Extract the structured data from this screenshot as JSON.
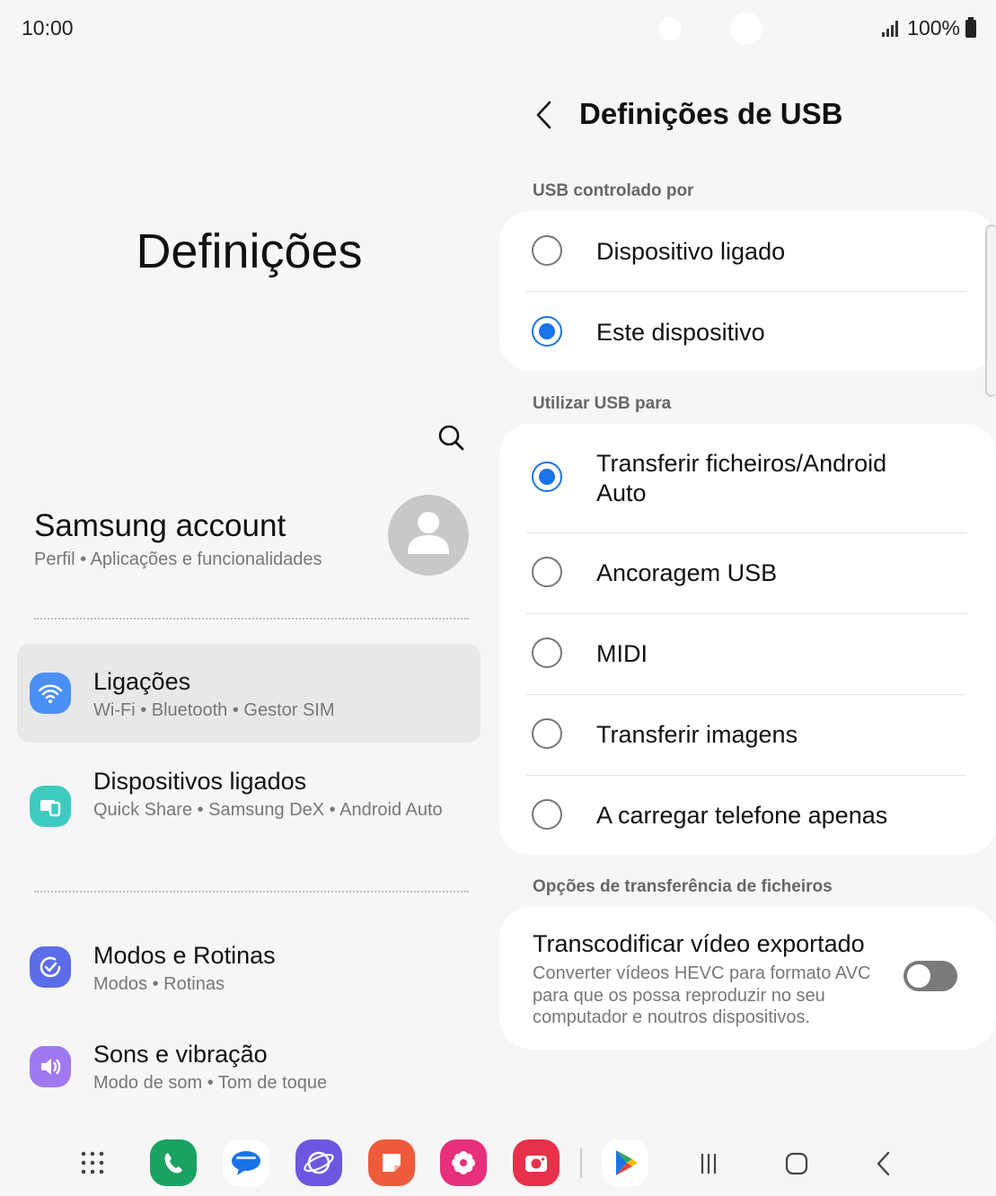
{
  "status_bar": {
    "time": "10:00",
    "battery": "100%",
    "icons": [
      "signal-icon",
      "battery-icon"
    ]
  },
  "left_pane": {
    "title": "Definições",
    "account": {
      "title": "Samsung account",
      "subtitle": "Perfil  •  Aplicações e funcionalidades"
    },
    "items": [
      {
        "title": "Ligações",
        "subtitle": "Wi-Fi  •  Bluetooth  •  Gestor SIM",
        "icon": "wifi-icon",
        "color": "#4a90f7"
      },
      {
        "title": "Dispositivos ligados",
        "subtitle": "Quick Share  •  Samsung DeX  •  Android Auto",
        "icon": "connected-devices-icon",
        "color": "#3ecbbf"
      },
      {
        "title": "Modos e Rotinas",
        "subtitle": "Modos  •  Rotinas",
        "icon": "modes-routines-icon",
        "color": "#5b6de8"
      },
      {
        "title": "Sons e vibração",
        "subtitle": "Modo de som  •  Tom de toque",
        "icon": "sound-icon",
        "color": "#a078ef"
      }
    ]
  },
  "right_pane": {
    "header_title": "Definições de USB",
    "sections": [
      {
        "label": "USB controlado por",
        "options": [
          {
            "label": "Dispositivo ligado",
            "checked": false
          },
          {
            "label": "Este dispositivo",
            "checked": true
          }
        ]
      },
      {
        "label": "Utilizar USB para",
        "options": [
          {
            "label": "Transferir ficheiros/Android Auto",
            "checked": true
          },
          {
            "label": "Ancoragem USB",
            "checked": false
          },
          {
            "label": "MIDI",
            "checked": false
          },
          {
            "label": "Transferir imagens",
            "checked": false
          },
          {
            "label": "A carregar telefone apenas",
            "checked": false
          }
        ]
      },
      {
        "label": "Opções de transferência de ficheiros",
        "toggle": {
          "title": "Transcodificar vídeo exportado",
          "description": "Converter vídeos HEVC para formato AVC para que os possa reproduzir no seu computador e noutros dispositivos.",
          "enabled": false
        }
      }
    ]
  },
  "dock": {
    "apps": [
      {
        "name": "apps-grid-icon"
      },
      {
        "name": "phone-icon",
        "color": "#1aa260"
      },
      {
        "name": "messages-icon",
        "color": "#1a73e8"
      },
      {
        "name": "internet-icon",
        "color": "#6e56e0"
      },
      {
        "name": "notes-icon",
        "color": "#ef5a3a"
      },
      {
        "name": "gallery-icon",
        "color": "#e8307a"
      },
      {
        "name": "camera-icon",
        "color": "#e8304a"
      },
      {
        "name": "play-store-icon"
      }
    ],
    "nav": [
      "recents-icon",
      "home-icon",
      "back-icon"
    ]
  }
}
